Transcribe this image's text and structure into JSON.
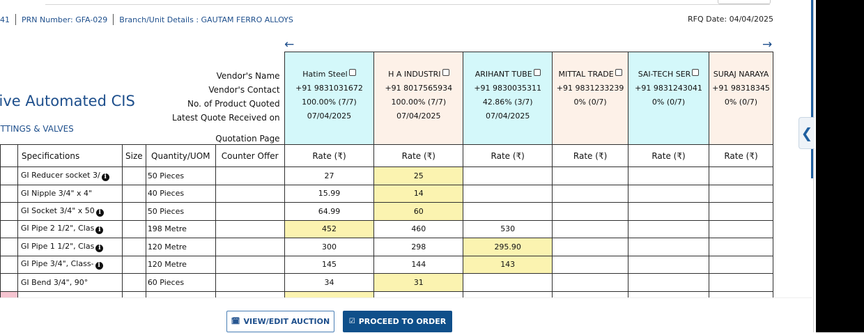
{
  "infobar": {
    "prefix": "41",
    "prn": "PRN Number: GFA-029",
    "branch": "Branch/Unit Details : GAUTAM FERRO ALLOYS",
    "rfq_date": "RFQ Date: 04/04/2025"
  },
  "nav": {
    "prev_arrow": "←",
    "next_arrow": "→"
  },
  "cis": {
    "title": "ive Automated CIS",
    "subtitle": "TTINGS & VALVES"
  },
  "row_labels": {
    "vendor_name": "Vendor's Name",
    "vendor_contact": "Vendor's Contact",
    "products_quoted": "No. of Product Quoted",
    "latest_quote": "Latest Quote Received on",
    "quotation_page": "Quotation Page"
  },
  "columns": {
    "specifications": "Specifications",
    "size": "Size",
    "quantity": "Quantity/UOM",
    "counter_offer": "Counter Offer",
    "rate": "Rate (₹)"
  },
  "vendors": [
    {
      "name": "Hatim Steel",
      "contact": "+91 9831031672",
      "quoted": "100.00% (7/7)",
      "date": "07/04/2025",
      "bg": "#d4f8fa"
    },
    {
      "name": "H A INDUSTRI",
      "contact": "+91 8017565934",
      "quoted": "100.00% (7/7)",
      "date": "07/04/2025",
      "bg": "#fdf1e8"
    },
    {
      "name": "ARIHANT TUBE",
      "contact": "+91 9830035311",
      "quoted": "42.86% (3/7)",
      "date": "07/04/2025",
      "bg": "#d4f8fa"
    },
    {
      "name": "MITTAL TRADE",
      "contact": "+91 9831233239",
      "quoted": "0% (0/7)",
      "date": "",
      "bg": "#fdf1e8"
    },
    {
      "name": "SAI-TECH SER",
      "contact": "+91 9831243041",
      "quoted": "0% (0/7)",
      "date": "",
      "bg": "#d4f8fa"
    },
    {
      "name": "SURAJ NARAYA",
      "contact": "+91 98318345",
      "quoted": "0% (0/7)",
      "date": "",
      "bg": "#fdf1e8"
    }
  ],
  "items": [
    {
      "spec": "GI Reducer socket 3/",
      "info": true,
      "size": "",
      "qty": "50 Pieces",
      "rates": [
        "27",
        "25",
        "",
        "",
        "",
        ""
      ],
      "lowest": 1
    },
    {
      "spec": "GI Nipple 3/4\" x 4\"",
      "info": false,
      "size": "",
      "qty": "40 Pieces",
      "rates": [
        "15.99",
        "14",
        "",
        "",
        "",
        ""
      ],
      "lowest": 1
    },
    {
      "spec": "GI Socket 3/4\" x 50",
      "info": true,
      "size": "",
      "qty": "50 Pieces",
      "rates": [
        "64.99",
        "60",
        "",
        "",
        "",
        ""
      ],
      "lowest": 1
    },
    {
      "spec": "GI Pipe 2 1/2\", Clas",
      "info": true,
      "size": "",
      "qty": "198 Metre",
      "rates": [
        "452",
        "460",
        "530",
        "",
        "",
        ""
      ],
      "lowest": 0
    },
    {
      "spec": "GI Pipe 1 1/2\", Clas",
      "info": true,
      "size": "",
      "qty": "120 Metre",
      "rates": [
        "300",
        "298",
        "295.90",
        "",
        "",
        ""
      ],
      "lowest": 2
    },
    {
      "spec": "GI Pipe 3/4\", Class-",
      "info": true,
      "size": "",
      "qty": "120 Metre",
      "rates": [
        "145",
        "144",
        "143",
        "",
        "",
        ""
      ],
      "lowest": 2
    },
    {
      "spec": "GI Bend 3/4\", 90°",
      "info": false,
      "size": "",
      "qty": "60 Pieces",
      "rates": [
        "34",
        "31",
        "",
        "",
        "",
        ""
      ],
      "lowest": 1
    }
  ],
  "buttons": {
    "view_edit": "VIEW/EDIT AUCTION",
    "proceed": "PROCEED TO ORDER"
  },
  "side_tab_icon": "chevron-left-icon",
  "colors": {
    "primary": "#0f4f8a",
    "lowest_bid": "#fbf3b0",
    "vendor_blue": "#d4f8fa",
    "vendor_peach": "#fdf1e8"
  }
}
